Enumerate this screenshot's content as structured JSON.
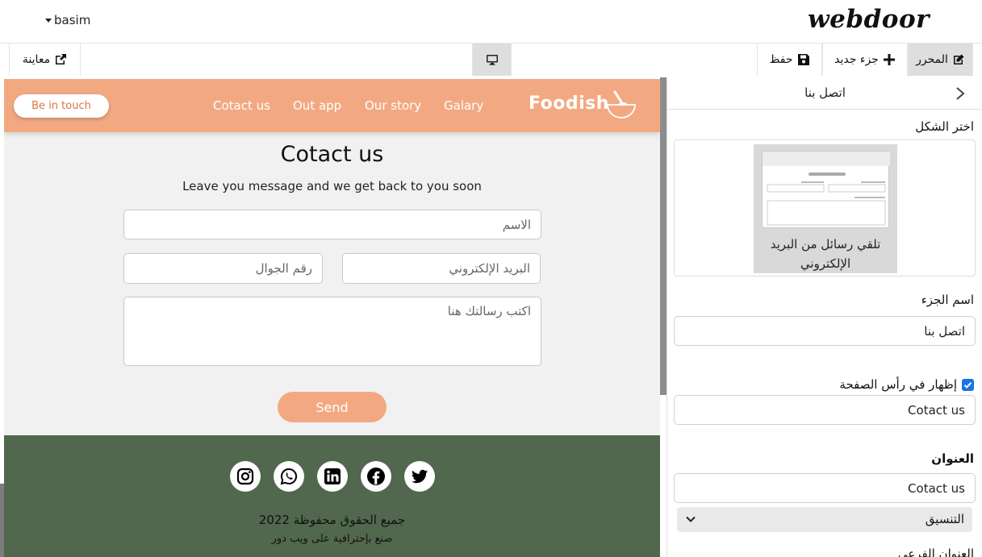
{
  "topbar": {
    "user": "basim",
    "logo": "webdoor"
  },
  "toolbar": {
    "editor_label": "المحرر",
    "new_section_label": "جزء جديد",
    "save_label": "حفظ",
    "preview_label": "معاينة",
    "device_icon": "desktop-icon"
  },
  "site": {
    "nav": {
      "cta": "Be in touch",
      "links": [
        "Cotact us",
        "Out app",
        "Our story",
        "Galary"
      ],
      "brand": "Foodish"
    },
    "contact": {
      "title": "Cotact us",
      "subtitle": "Leave you message and we get back to you soon",
      "name_placeholder": "الاسم",
      "email_placeholder": "البريد الإلكتروني",
      "phone_placeholder": "رقم الجوال",
      "message_placeholder": "اكتب رسالتك هنا",
      "send_label": "Send"
    },
    "footer": {
      "social": [
        "instagram-icon",
        "whatsapp-icon",
        "linkedin-icon",
        "facebook-icon",
        "twitter-icon"
      ],
      "copyright": "جميع الحقوق محفوظة 2022",
      "made_by": "صنع بإحترافية على ويب دور"
    },
    "colors": {
      "accent": "#f2a982",
      "footer": "#52684e",
      "cta_text": "#d7773f"
    }
  },
  "panel": {
    "header_title": "اتصل بنا",
    "choose_layout_label": "اختر الشكل",
    "layout_option_line1": "تلقي رسائل من البريد",
    "layout_option_line2": "الإلكتروني",
    "section_name_label": "اسم الجزء",
    "section_name_value": "اتصل بنا",
    "show_in_header_label": "إظهار في رأس الصفحة",
    "show_in_header_checked": true,
    "header_text_value": "Cotact us",
    "title_label": "العنوان",
    "title_value": "Cotact us",
    "format_label": "التنسيق",
    "cut_label": "العنوان الفرعي",
    "colors": {
      "checkbox": "#1a73e8"
    }
  }
}
